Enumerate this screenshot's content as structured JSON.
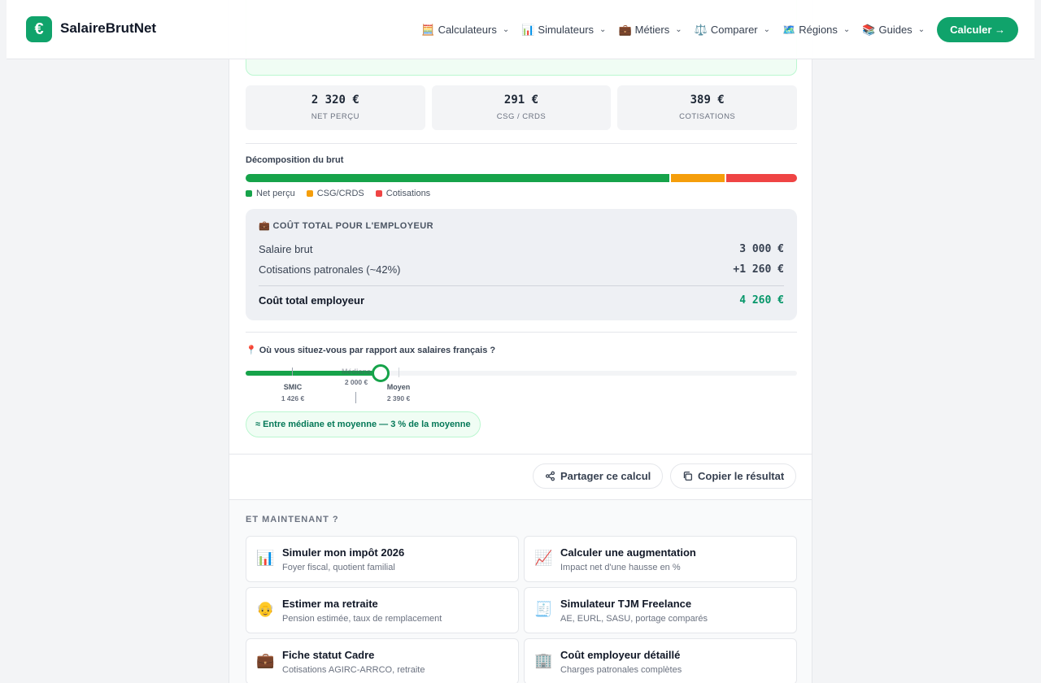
{
  "header": {
    "logo_symbol": "€",
    "brand": "SalaireBrutNet",
    "nav": [
      {
        "icon": "🧮",
        "label": "Calculateurs"
      },
      {
        "icon": "📊",
        "label": "Simulateurs"
      },
      {
        "icon": "💼",
        "label": "Métiers"
      },
      {
        "icon": "⚖️",
        "label": "Comparer"
      },
      {
        "icon": "🗺️",
        "label": "Régions"
      },
      {
        "icon": "📚",
        "label": "Guides"
      }
    ],
    "cta": "Calculer →"
  },
  "stats": [
    {
      "value": "2 320 €",
      "label": "NET PERÇU"
    },
    {
      "value": "291 €",
      "label": "CSG / CRDS"
    },
    {
      "value": "389 €",
      "label": "COTISATIONS"
    }
  ],
  "breakdown": {
    "title": "Décomposition du brut",
    "segments": [
      {
        "name": "Net perçu",
        "fraction": 0.7733,
        "color": "#16a34a"
      },
      {
        "name": "CSG/CRDS",
        "fraction": 0.097,
        "color": "#f59e0b"
      },
      {
        "name": "Cotisations",
        "fraction": 0.1297,
        "color": "#ef4444"
      }
    ]
  },
  "employer": {
    "heading": "💼 COÛT TOTAL POUR L'EMPLOYEUR",
    "rows": [
      {
        "label": "Salaire brut",
        "value": "3 000 €"
      },
      {
        "label": "Cotisations patronales (~42%)",
        "value": "+1 260 €"
      }
    ],
    "total_label": "Coût total employeur",
    "total_value": "4 260 €"
  },
  "position": {
    "title": "📍 Où vous situez-vous par rapport aux salaires français ?",
    "level_fraction": 0.245,
    "markers": [
      {
        "name": "SMIC",
        "value": "1 426 €"
      },
      {
        "name": "Médiane",
        "value": "2 000 €"
      },
      {
        "name": "Moyen",
        "value": "2 390 €"
      }
    ],
    "badge": "≈ Entre médiane et moyenne — 3 % de la moyenne"
  },
  "actions": {
    "share": "Partager ce calcul",
    "copy": "Copier le résultat"
  },
  "next": {
    "title": "ET MAINTENANT ?",
    "tiles": [
      {
        "icon": "📊",
        "title": "Simuler mon impôt 2026",
        "sub": "Foyer fiscal, quotient familial"
      },
      {
        "icon": "📈",
        "title": "Calculer une augmentation",
        "sub": "Impact net d'une hausse en %"
      },
      {
        "icon": "👴",
        "title": "Estimer ma retraite",
        "sub": "Pension estimée, taux de remplacement"
      },
      {
        "icon": "🧾",
        "title": "Simulateur TJM Freelance",
        "sub": "AE, EURL, SASU, portage comparés"
      },
      {
        "icon": "💼",
        "title": "Fiche statut Cadre",
        "sub": "Cotisations AGIRC-ARRCO, retraite"
      },
      {
        "icon": "🏢",
        "title": "Coût employeur détaillé",
        "sub": "Charges patronales complètes"
      }
    ]
  }
}
